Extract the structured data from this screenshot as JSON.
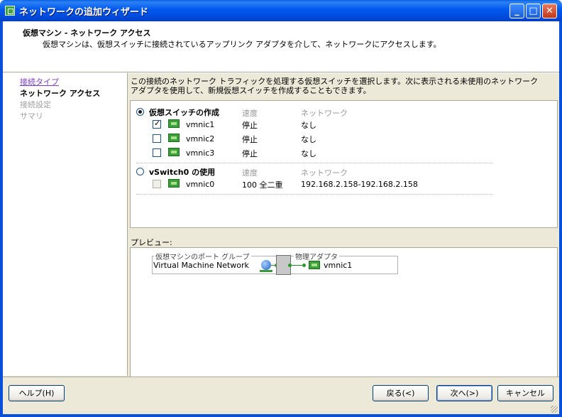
{
  "window": {
    "title": "ネットワークの追加ウィザード",
    "minimize": "_",
    "maximize": "□",
    "close": "✕"
  },
  "header": {
    "title": "仮想マシン - ネットワーク アクセス",
    "description": "仮想マシンは、仮想スイッチに接続されているアップリンク アダプタを介して、ネットワークにアクセスします。"
  },
  "nav": {
    "items": [
      {
        "label": "接続タイプ",
        "state": "link"
      },
      {
        "label": "ネットワーク アクセス",
        "state": "active"
      },
      {
        "label": "接続設定",
        "state": "disabled"
      },
      {
        "label": "サマリ",
        "state": "disabled"
      }
    ]
  },
  "instructions": "この接続のネットワーク トラフィックを処理する仮想スイッチを選択します。次に表示される未使用のネットワーク アダプタを使用して、新規仮想スイッチを作成することもできます。",
  "create_switch": {
    "label": "仮想スイッチの作成",
    "selected": true,
    "col_speed": "速度",
    "col_network": "ネットワーク",
    "adapters": [
      {
        "name": "vmnic1",
        "checked": true,
        "speed": "停止",
        "network": "なし"
      },
      {
        "name": "vmnic2",
        "checked": false,
        "speed": "停止",
        "network": "なし"
      },
      {
        "name": "vmnic3",
        "checked": false,
        "speed": "停止",
        "network": "なし"
      }
    ]
  },
  "use_vswitch": {
    "label": "vSwitch0 の使用",
    "selected": false,
    "col_speed": "速度",
    "col_network": "ネットワーク",
    "adapters": [
      {
        "name": "vmnic0",
        "checked": false,
        "speed": "100 全二重",
        "network": "192.168.2.158-192.168.2.158"
      }
    ]
  },
  "preview": {
    "label": "プレビュー:",
    "port_group_legend": "仮想マシンのポート グループ",
    "port_group_name": "Virtual Machine Network",
    "physical_legend": "物理アダプタ",
    "physical_adapter": "vmnic1"
  },
  "buttons": {
    "help": "ヘルプ(H)",
    "back": "戻る(<)",
    "next": "次へ(>)",
    "cancel": "キャンセル"
  },
  "colors": {
    "titlebar": "#0058ee",
    "window_bg": "#ece9d8",
    "link": "#7b3fbf"
  }
}
